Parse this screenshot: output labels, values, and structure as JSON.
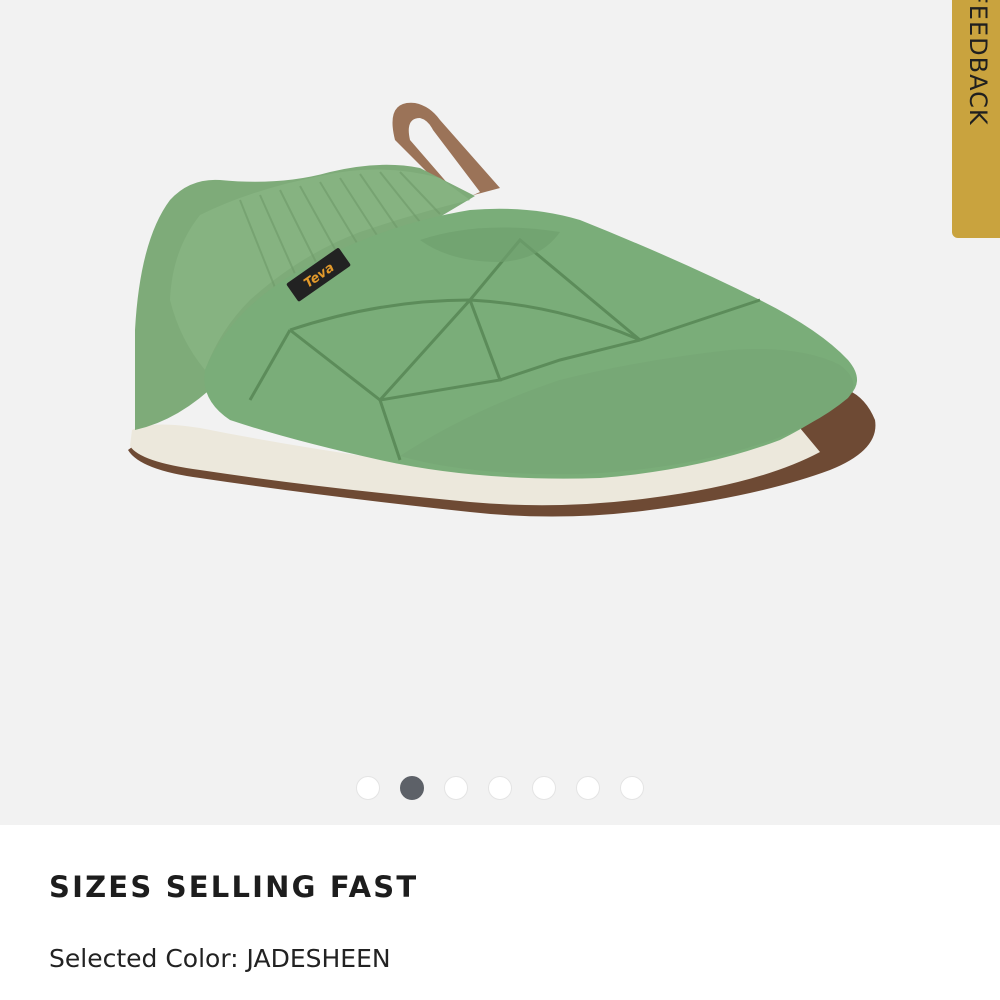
{
  "feedback": {
    "label": "FEEDBACK"
  },
  "product": {
    "image_alt": "Green quilted slip-on shoe with knit collar, tan pull loop and brown rubber sole",
    "logo_text": "Teva"
  },
  "gallery": {
    "slide_count": 7,
    "active_index": 1
  },
  "info": {
    "heading": "SIZES SELLING FAST",
    "color_label": "Selected Color:",
    "color_value": "JADESHEEN"
  },
  "colors": {
    "feedback_bg": "#c9a33e",
    "shoe_green": "#7aad79",
    "dot_active": "#5d6168",
    "gallery_bg": "#f2f2f2"
  }
}
